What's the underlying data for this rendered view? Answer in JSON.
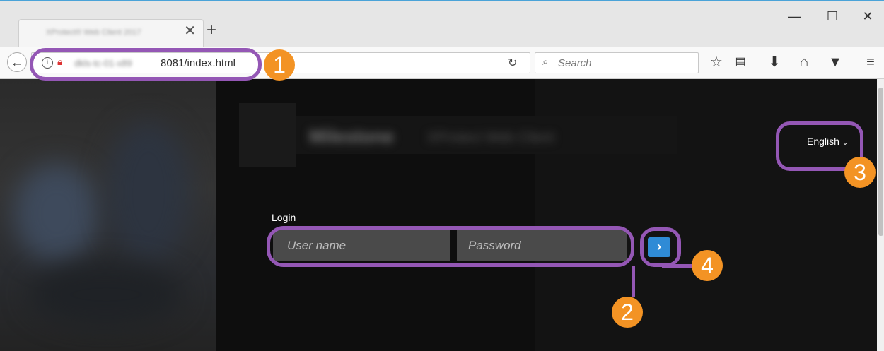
{
  "browser": {
    "tab_title": "XProtect® Web Client 2017",
    "tab_close": "✕",
    "new_tab": "+",
    "window": {
      "minimize": "—",
      "maximize": "☐",
      "close": "✕"
    },
    "url_host_blurred": "dkls-tc-01-x89",
    "url_visible": "8081/index.html",
    "search_placeholder": "Search"
  },
  "page": {
    "logo_text": "Milestone",
    "logo_subtext": "XProtect Web Client",
    "language_label": "English",
    "login_label": "Login",
    "username_placeholder": "User name",
    "password_placeholder": "Password",
    "submit_glyph": "›"
  },
  "callouts": [
    "1",
    "2",
    "3",
    "4"
  ],
  "colors": {
    "highlight": "#9457b5",
    "callout": "#f39324",
    "button": "#2f8bd6"
  }
}
